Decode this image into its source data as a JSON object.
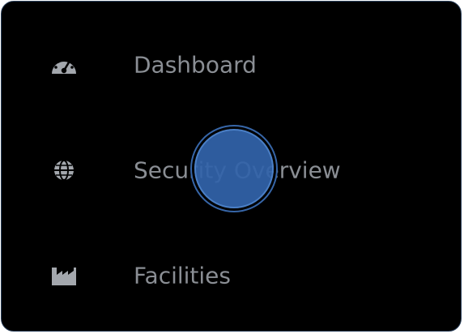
{
  "sidebar": {
    "items": [
      {
        "label": "Dashboard",
        "icon": "gauge-icon"
      },
      {
        "label": "Security Overview",
        "icon": "globe-icon"
      },
      {
        "label": "Facilities",
        "icon": "factory-icon"
      }
    ]
  },
  "colors": {
    "background": "#000000",
    "label": "#8a8e94",
    "icon": "#a3a7ad",
    "cursor_highlight": "#3163aa",
    "border": "#2a3f5a"
  }
}
